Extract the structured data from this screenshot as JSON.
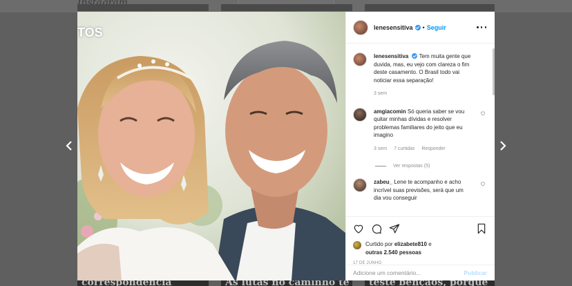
{
  "background": {
    "logo": "Instagram",
    "bottom_texts": [
      "correspondência",
      "As lutas no caminho te fazem",
      "teste bênçãos, porque"
    ]
  },
  "photo": {
    "overlay_text": "TOS"
  },
  "post": {
    "username": "lenesensitiva",
    "verified": true,
    "follow_label": "Seguir",
    "caption": {
      "username": "lenesensitiva",
      "text": "Tem muita gente que duvida, mas, eu vejo com clareza o fim deste casamento. O Brasil todo vai noticiar essa separação!",
      "time": "3 sem"
    },
    "comments": [
      {
        "username": "amgiacomin",
        "text": "Só queria saber se vou quitar minhas dívidas e resolver problemas familiares do jeito que eu imagino",
        "time": "3 sem",
        "likes": "7 curtidas",
        "reply_label": "Responder",
        "view_replies": "Ver respostas (5)"
      },
      {
        "username": "zabeu_",
        "text": "Lene te acompanho e acho incrível suas previsões, será que um dia vou conseguir"
      }
    ],
    "liked_by_prefix": "Curtido por",
    "liked_by_user": "elizabete810",
    "liked_by_suffix": "e",
    "others": "outras 2.540 pessoas",
    "date": "17 DE JUNHO",
    "comment_placeholder": "Adicione um comentário...",
    "publish_label": "Publicar"
  },
  "colors": {
    "accent": "#0095f6",
    "verified": "#3897f0",
    "muted": "#8e8e8e"
  },
  "icons": [
    "heart-icon",
    "comment-icon",
    "share-icon",
    "bookmark-icon",
    "more-icon",
    "chevron-left-icon",
    "chevron-right-icon",
    "verified-icon"
  ]
}
